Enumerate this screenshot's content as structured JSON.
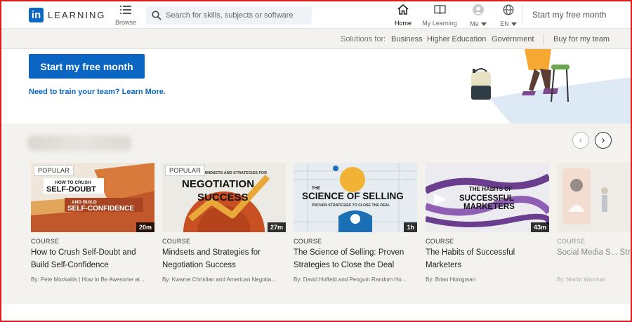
{
  "brand": {
    "logo_mark": "in",
    "wordmark": "LEARNING"
  },
  "nav": {
    "browse": "Browse",
    "search_placeholder": "Search for skills, subjects or software",
    "home": "Home",
    "my_learning": "My Learning",
    "me": "Me",
    "language": "EN",
    "start_trial": "Start my free month"
  },
  "solutions": {
    "lead": "Solutions for:",
    "business": "Business",
    "higher_ed": "Higher Education",
    "government": "Government",
    "buy_team": "Buy for my team"
  },
  "hero": {
    "cta": "Start my free month",
    "learn_more": "Need to train your team? Learn More."
  },
  "courses": [
    {
      "badge": "POPULAR",
      "duration": "20m",
      "type": "COURSE",
      "title": "How to Crush Self-Doubt and Build Self-Confidence",
      "authors": "By: Pete Mockaitis | How to Be Awesome at...",
      "thumb_text": [
        "HOW TO CRUSH",
        "SELF-DOUBT",
        "AND BUILD",
        "SELF-CONFIDENCE"
      ]
    },
    {
      "badge": "POPULAR",
      "duration": "27m",
      "type": "COURSE",
      "title": "Mindsets and Strategies for Negotiation Success",
      "authors": "By: Kwame Christian and American Negotia...",
      "thumb_text": [
        "MINDSETS AND STRATEGIES FOR",
        "NEGOTIATION",
        "SUCCESS"
      ]
    },
    {
      "badge": "",
      "duration": "1h",
      "type": "COURSE",
      "title": "The Science of Selling: Proven Strategies to Close the Deal",
      "authors": "By: David Hoffeld and Penguin Random Ho...",
      "thumb_text": [
        "THE",
        "SCIENCE OF SELLING",
        "PROVEN STRATEGIES TO CLOSE THE DEAL"
      ]
    },
    {
      "badge": "",
      "duration": "43m",
      "type": "COURSE",
      "title": "The Habits of Successful Marketers",
      "authors": "By: Brian Honigman",
      "thumb_text": [
        "THE HABITS OF",
        "SUCCESSFUL",
        "MARKETERS"
      ]
    },
    {
      "badge": "",
      "duration": "",
      "type": "COURSE",
      "title": "Social Media S... Strategies and...",
      "authors": "By: Martin Waxman",
      "thumb_text": []
    }
  ],
  "colors": {
    "brand_blue": "#0a66c2",
    "section_bg": "#f3f2ef",
    "frame_red": "#e01b1b"
  }
}
